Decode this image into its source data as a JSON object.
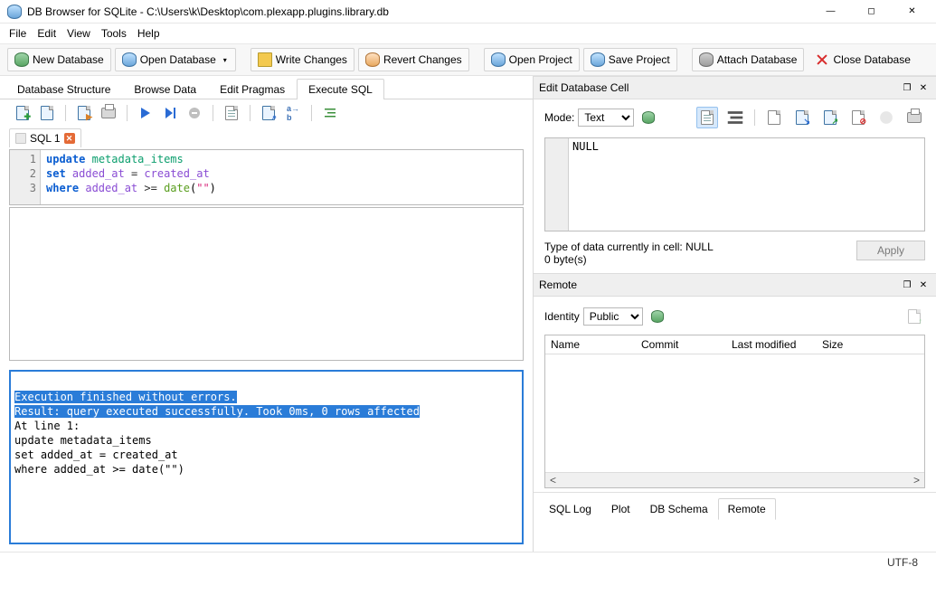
{
  "window": {
    "title": "DB Browser for SQLite - C:\\Users\\k\\Desktop\\com.plexapp.plugins.library.db"
  },
  "menu": [
    "File",
    "Edit",
    "View",
    "Tools",
    "Help"
  ],
  "main_toolbar": {
    "new_db": "New Database",
    "open_db": "Open Database",
    "write": "Write Changes",
    "revert": "Revert Changes",
    "open_proj": "Open Project",
    "save_proj": "Save Project",
    "attach": "Attach Database",
    "close": "Close Database"
  },
  "main_tabs": [
    "Database Structure",
    "Browse Data",
    "Edit Pragmas",
    "Execute SQL"
  ],
  "active_main_tab": 3,
  "sql_tab": {
    "label": "SQL 1"
  },
  "code_lines": [
    {
      "n": "1",
      "html": "<span class='kw'>update</span> <span class='ident'>metadata_items</span>"
    },
    {
      "n": "2",
      "html": "<span class='kw'>set</span> <span class='col'>added_at</span> <span class='op'>=</span> <span class='col'>created_at</span>"
    },
    {
      "n": "3",
      "html": "<span class='kw'>where</span> <span class='col'>added_at</span> <span class='op'>&gt;=</span> <span class='fn'>date</span>(<span class='str'>\"\"</span>)"
    }
  ],
  "output": {
    "sel1": "Execution finished without errors.",
    "sel2": "Result: query executed successfully. Took 0ms, 0 rows affected",
    "line3": "At line 1:",
    "line4": "update metadata_items",
    "line5": "set added_at = created_at",
    "line6": "where added_at >= date(\"\")"
  },
  "edit_cell": {
    "title": "Edit Database Cell",
    "mode_label": "Mode:",
    "mode_value": "Text",
    "null": "NULL",
    "type_info": "Type of data currently in cell: NULL",
    "size": "0 byte(s)",
    "apply": "Apply"
  },
  "remote": {
    "title": "Remote",
    "identity_label": "Identity",
    "identity_value": "Public",
    "cols": [
      "Name",
      "Commit",
      "Last modified",
      "Size"
    ]
  },
  "bottom_tabs": [
    "SQL Log",
    "Plot",
    "DB Schema",
    "Remote"
  ],
  "active_bottom_tab": 3,
  "status": {
    "encoding": "UTF-8"
  }
}
